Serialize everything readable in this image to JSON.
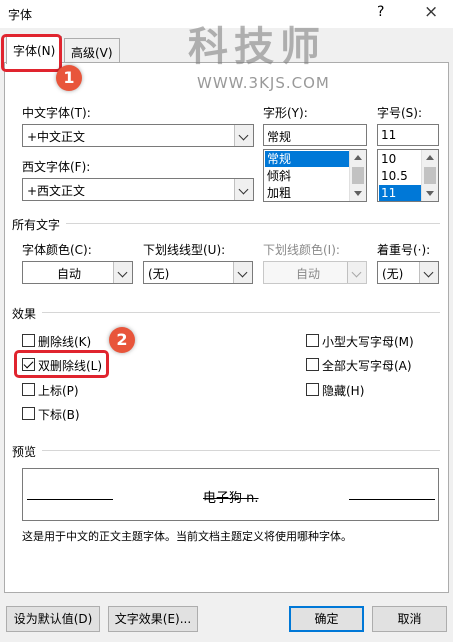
{
  "window": {
    "title": "字体",
    "help": "?",
    "close": "×"
  },
  "tabs": [
    {
      "label": "字体(N)",
      "active": true
    },
    {
      "label": "高级(V)",
      "active": false
    }
  ],
  "font": {
    "chinese_font_label": "中文字体(T):",
    "chinese_font_value": "+中文正文",
    "western_font_label": "西文字体(F):",
    "western_font_value": "+西文正文",
    "style_label": "字形(Y):",
    "style_value": "常规",
    "style_options": [
      "常规",
      "倾斜",
      "加粗"
    ],
    "size_label": "字号(S):",
    "size_value": "11",
    "size_options": [
      "10",
      "10.5",
      "11"
    ]
  },
  "all_text": {
    "section_label": "所有文字",
    "color_label": "字体颜色(C):",
    "color_value": "自动",
    "underline_style_label": "下划线线型(U):",
    "underline_style_value": "(无)",
    "underline_color_label": "下划线颜色(I):",
    "underline_color_value": "自动",
    "emphasis_label": "着重号(·):",
    "emphasis_value": "(无)"
  },
  "effects": {
    "section_label": "效果",
    "left": [
      {
        "label": "删除线(K)",
        "checked": false
      },
      {
        "label": "双删除线(L)",
        "checked": true
      },
      {
        "label": "上标(P)",
        "checked": false
      },
      {
        "label": "下标(B)",
        "checked": false
      }
    ],
    "right": [
      {
        "label": "小型大写字母(M)",
        "checked": false
      },
      {
        "label": "全部大写字母(A)",
        "checked": false
      },
      {
        "label": "隐藏(H)",
        "checked": false
      }
    ]
  },
  "preview": {
    "section_label": "预览",
    "sample_text": "电子狗 n.",
    "description": "这是用于中文的正文主题字体。当前文档主题定义将使用哪种字体。"
  },
  "buttons": {
    "set_default": "设为默认值(D)",
    "text_effects": "文字效果(E)...",
    "ok": "确定",
    "cancel": "取消"
  },
  "annotations": {
    "marker_1": "1",
    "marker_2": "2"
  },
  "watermark": {
    "main": "科技师",
    "sub": "WWW.3KJS.COM"
  },
  "colors": {
    "accent": "#0078d7",
    "highlight": "#e0242e",
    "marker": "#e8553b"
  }
}
